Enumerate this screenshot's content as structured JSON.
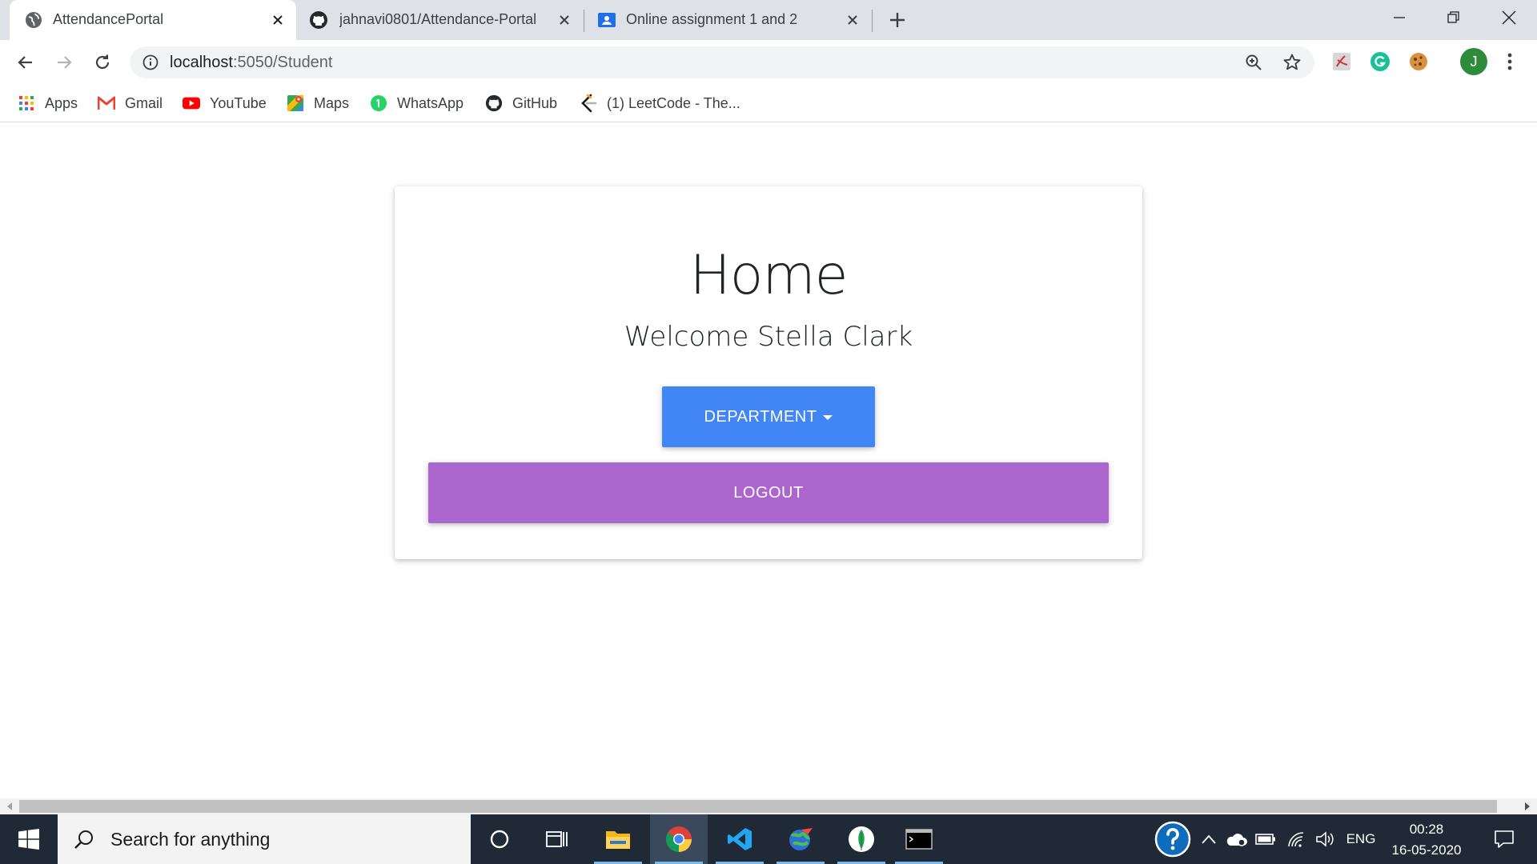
{
  "browser": {
    "tabs": [
      {
        "title": "AttendancePortal",
        "icon": "globe-icon",
        "active": true
      },
      {
        "title": "jahnavi0801/Attendance-Portal",
        "icon": "github-icon",
        "active": false
      },
      {
        "title": "Online assignment 1 and 2",
        "icon": "classroom-icon",
        "active": false
      }
    ],
    "url_host": "localhost",
    "url_path": ":5050/Student",
    "bookmarks": [
      {
        "label": "Apps",
        "icon": "apps-grid-icon"
      },
      {
        "label": "Gmail",
        "icon": "gmail-icon"
      },
      {
        "label": "YouTube",
        "icon": "youtube-icon"
      },
      {
        "label": "Maps",
        "icon": "maps-icon"
      },
      {
        "label": "WhatsApp",
        "icon": "whatsapp-icon"
      },
      {
        "label": "GitHub",
        "icon": "github-icon"
      },
      {
        "label": "(1) LeetCode - The...",
        "icon": "leetcode-icon"
      }
    ],
    "profile_initial": "J"
  },
  "page": {
    "title": "Home",
    "welcome": "Welcome Stella Clark",
    "department_button": "DEPARTMENT",
    "logout_button": "LOGOUT",
    "colors": {
      "department": "#4285f4",
      "logout": "#aa66cc"
    }
  },
  "taskbar": {
    "search_placeholder": "Search for anything",
    "language": "ENG",
    "time": "00:28",
    "date": "16-05-2020"
  }
}
